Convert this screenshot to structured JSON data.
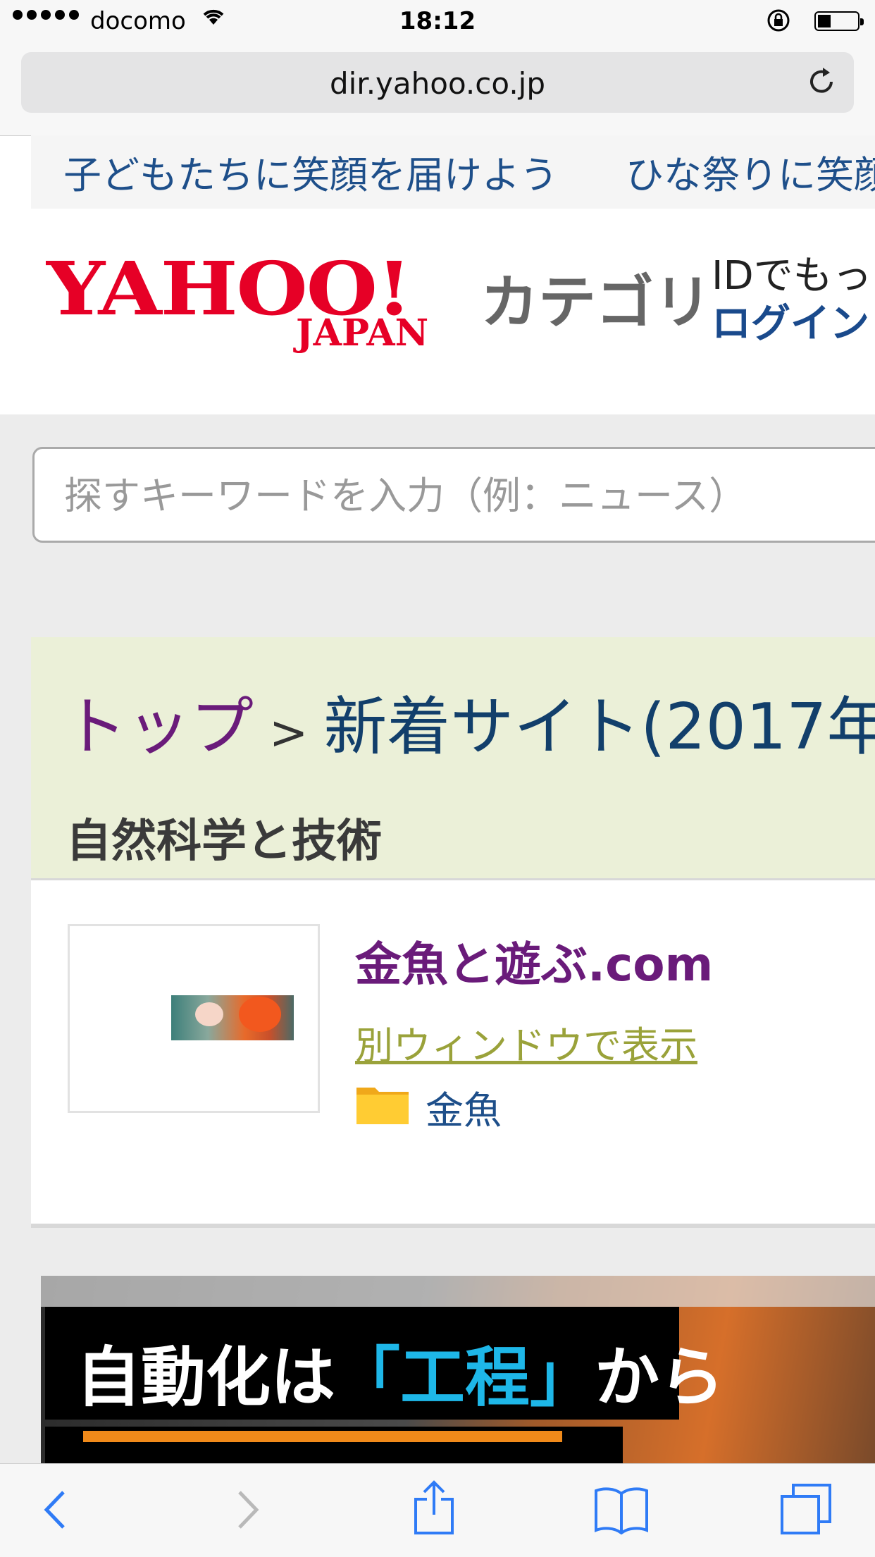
{
  "status_bar": {
    "carrier": "docomo",
    "time": "18:12",
    "battery_level": 0.3
  },
  "browser": {
    "url": "dir.yahoo.co.jp"
  },
  "ticker": {
    "items": [
      "子どもたちに笑顔を届けよう",
      "ひな祭りに笑顔"
    ]
  },
  "header": {
    "logo_yahoo": "YAHOO!",
    "logo_japan": "JAPAN",
    "logo_category": "カテゴリ",
    "id_text": "IDでもっ",
    "login_label": "ログイン"
  },
  "search": {
    "placeholder": "探すキーワードを入力（例：ニュース）",
    "value": ""
  },
  "breadcrumb": {
    "top": "トップ",
    "separator": ">",
    "current": "新着サイト(2017年"
  },
  "section": {
    "title": "自然科学と技術"
  },
  "listing": {
    "site_title": "金魚と遊ぶ.com",
    "new_window_label": "別ウィンドウで表示",
    "category_label": "金魚"
  },
  "ad": {
    "text_prefix": "自動化は",
    "text_highlight": "「工程」",
    "text_suffix": "から"
  },
  "colors": {
    "yahoo_red": "#e60026",
    "visited_link": "#6a1b7a",
    "link_blue": "#1e4f8a",
    "ios_blue": "#2f7bf6"
  }
}
